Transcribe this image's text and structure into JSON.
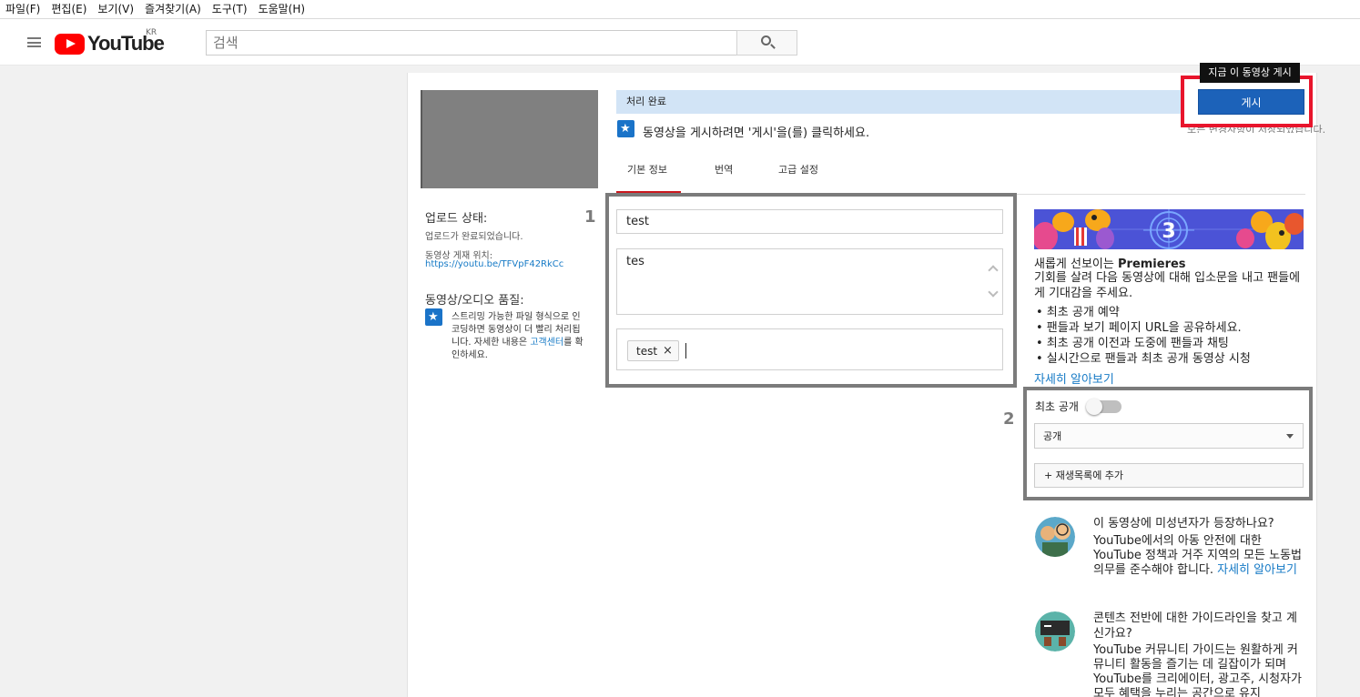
{
  "menubar": [
    "파일(F)",
    "편집(E)",
    "보기(V)",
    "즐겨찾기(A)",
    "도구(T)",
    "도움말(H)"
  ],
  "header": {
    "logo_text": "YouTube",
    "region": "KR",
    "search_placeholder": "검색"
  },
  "upload": {
    "progress_text": "처리 완료",
    "tooltip": "지금 이 동영상 게시",
    "publish_label": "게시",
    "saved_note": "모든 변경사항이 저장되었습니다.",
    "hint": "동영상을 게시하려면 '게시'을(를) 클릭하세요."
  },
  "tabs": [
    "기본 정보",
    "번역",
    "고급 설정"
  ],
  "status": {
    "upload_heading": "업로드 상태:",
    "upload_done": "업로드가 완료되었습니다.",
    "location_label": "동영상 게재 위치:",
    "video_link": "https://youtu.be/TFVpF42RkCc",
    "quality_heading": "동영상/오디오 품질:",
    "quality_text_1": "스트리밍 가능한 파일 형식으로 인코딩하면 동영상이 더 빨리 처리됩니다. 자세한 내용은 ",
    "quality_link": "고객센터",
    "quality_text_2": "를 확인하세요."
  },
  "annotations": {
    "box1": "1",
    "box2": "2"
  },
  "form": {
    "title_value": "test",
    "description_value": "tes",
    "tags": [
      "test"
    ],
    "tag_remove": "×"
  },
  "premieres": {
    "banner_number": "3",
    "heading_prefix": "새롭게 선보이는 ",
    "heading_bold": "Premieres",
    "paragraph": "기회를 살려 다음 동영상에 대해 입소문을 내고 팬들에게 기대감을 주세요.",
    "bullets": [
      "• 최초 공개 예약",
      "• 팬들과 보기 페이지 URL을 공유하세요.",
      "• 최초 공개 이전과 도중에 팬들과 채팅",
      "• 실시간으로 팬들과 최초 공개 동영상 시청"
    ],
    "learn_more": "자세히 알아보기"
  },
  "settings": {
    "premiere_label": "최초 공개",
    "premiere_on": false,
    "privacy_value": "공개",
    "playlist_label": "+ 재생목록에 추가"
  },
  "info": {
    "minors_heading": "이 동영상에 미성년자가 등장하나요?",
    "minors_text": "YouTube에서의 아동 안전에 대한 YouTube 정책과 거주 지역의 모든 노동법 의무를 준수해야 합니다. ",
    "minors_link": "자세히 알아보기",
    "guide_heading": "콘텐츠 전반에 대한 가이드라인을 찾고 계신가요?",
    "guide_text": "YouTube 커뮤니티 가이드는 원활하게 커뮤니티 활동을 즐기는 데 길잡이가 되며 YouTube를 크리에이터, 광고주, 시청자가 모두 혜택을 누리는 공간으로 유지"
  },
  "colors": {
    "accent_blue": "#1c62b9",
    "link_blue": "#167ac6",
    "highlight_red": "#e8152c",
    "annotation_gray": "#7b7b7b",
    "progress_bg": "#d2e4f6",
    "tab_active": "#cc181e"
  }
}
